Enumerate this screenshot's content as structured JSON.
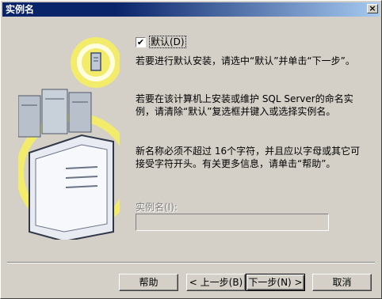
{
  "window": {
    "title": "实例名",
    "close_glyph": "×"
  },
  "default_checkbox": {
    "label": "默认(D)",
    "checked": true,
    "check_glyph": "✔"
  },
  "paragraphs": {
    "p1": "若要进行默认安装，请选中“默认”并单击“下一步”。",
    "p2": "若要在该计算机上安装或维护 SQL Server的命名实例，请清除“默认”复选框并键入或选择实例名。",
    "p3": "新名称必须不超过 16个字符，并且应以字母或其它可接受字符开头。有关更多信息，请单击“帮助”。"
  },
  "instance_name": {
    "label": "实例名(I):",
    "value": ""
  },
  "buttons": {
    "help": "帮助",
    "back": "< 上一步(B)",
    "next": "下一步(N) >",
    "cancel": "取消"
  },
  "colors": {
    "title_start": "#0a246a",
    "title_end": "#a6caf0",
    "face": "#d4d0c8",
    "accent_yellow": "#f2ec6a"
  },
  "icons": [
    "server-cluster-icon",
    "computer-tower-icon",
    "document-icon"
  ]
}
